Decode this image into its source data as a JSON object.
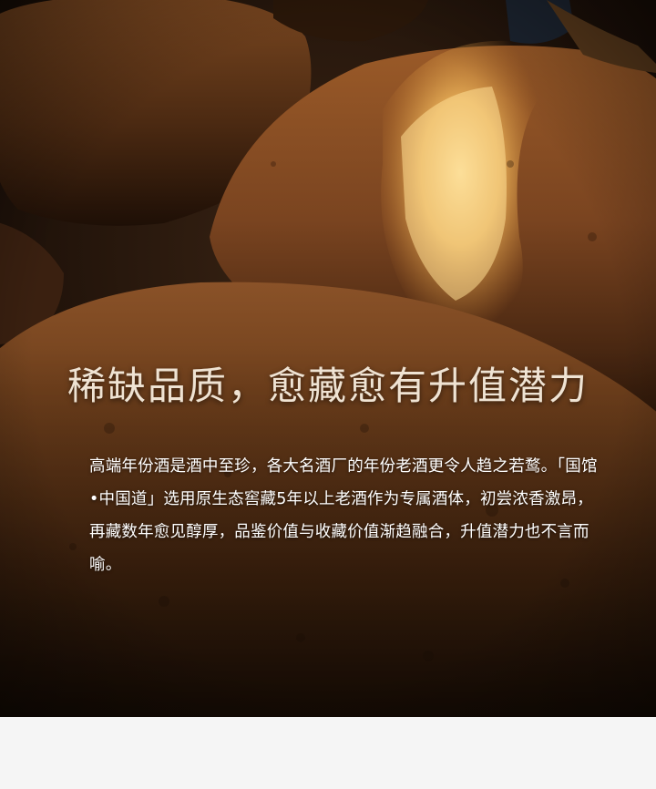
{
  "headline": "稀缺品质，愈藏愈有升值潜力",
  "paragraph": "高端年份酒是酒中至珍，各大名酒厂的年份老酒更令人趋之若鹜。「国馆•中国道」选用原生态窖藏5年以上老酒作为专属酒体，初尝浓香激昂，再藏数年愈见醇厚，品鉴价值与收藏价值渐趋融合，升值潜力也不言而喻。",
  "colors": {
    "jar": "#6b3a19",
    "shadow": "#1a0d05",
    "light": "#f2c36b",
    "footer": "#f5f5f5"
  }
}
